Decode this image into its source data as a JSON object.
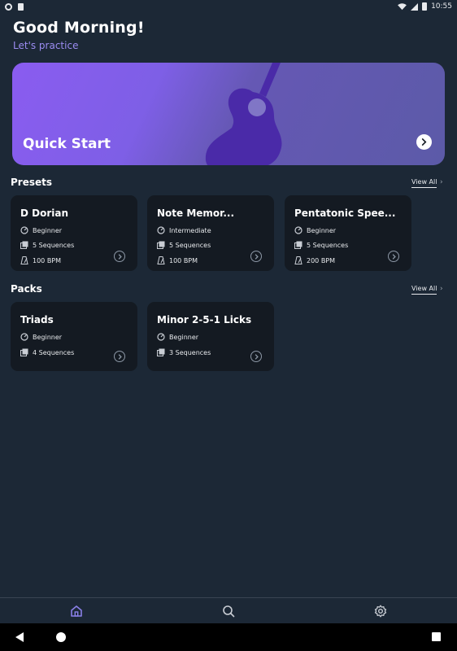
{
  "status": {
    "time": "10:55"
  },
  "header": {
    "greeting": "Good Morning!",
    "subtitle": "Let's practice"
  },
  "hero": {
    "title": "Quick Start"
  },
  "presets": {
    "title": "Presets",
    "view_all": "View All",
    "items": [
      {
        "title": "D Dorian",
        "level": "Beginner",
        "sequences": "5 Sequences",
        "bpm": "100 BPM"
      },
      {
        "title": "Note Memor...",
        "level": "Intermediate",
        "sequences": "5 Sequences",
        "bpm": "100 BPM"
      },
      {
        "title": "Pentatonic Spee...",
        "level": "Beginner",
        "sequences": "5 Sequences",
        "bpm": "200 BPM"
      }
    ]
  },
  "packs": {
    "title": "Packs",
    "view_all": "View All",
    "items": [
      {
        "title": "Triads",
        "level": "Beginner",
        "sequences": "4 Sequences"
      },
      {
        "title": "Minor 2-5-1 Licks",
        "level": "Beginner",
        "sequences": "3 Sequences"
      }
    ]
  },
  "nav": {
    "items": [
      "home-icon",
      "search-icon",
      "gear-icon"
    ]
  },
  "colors": {
    "background": "#1c2836",
    "card": "#141a22",
    "accent": "#9b8cf2",
    "hero_start": "#8a5cf0",
    "hero_end": "#5c5aa8",
    "guitar": "#4a2aa8"
  }
}
